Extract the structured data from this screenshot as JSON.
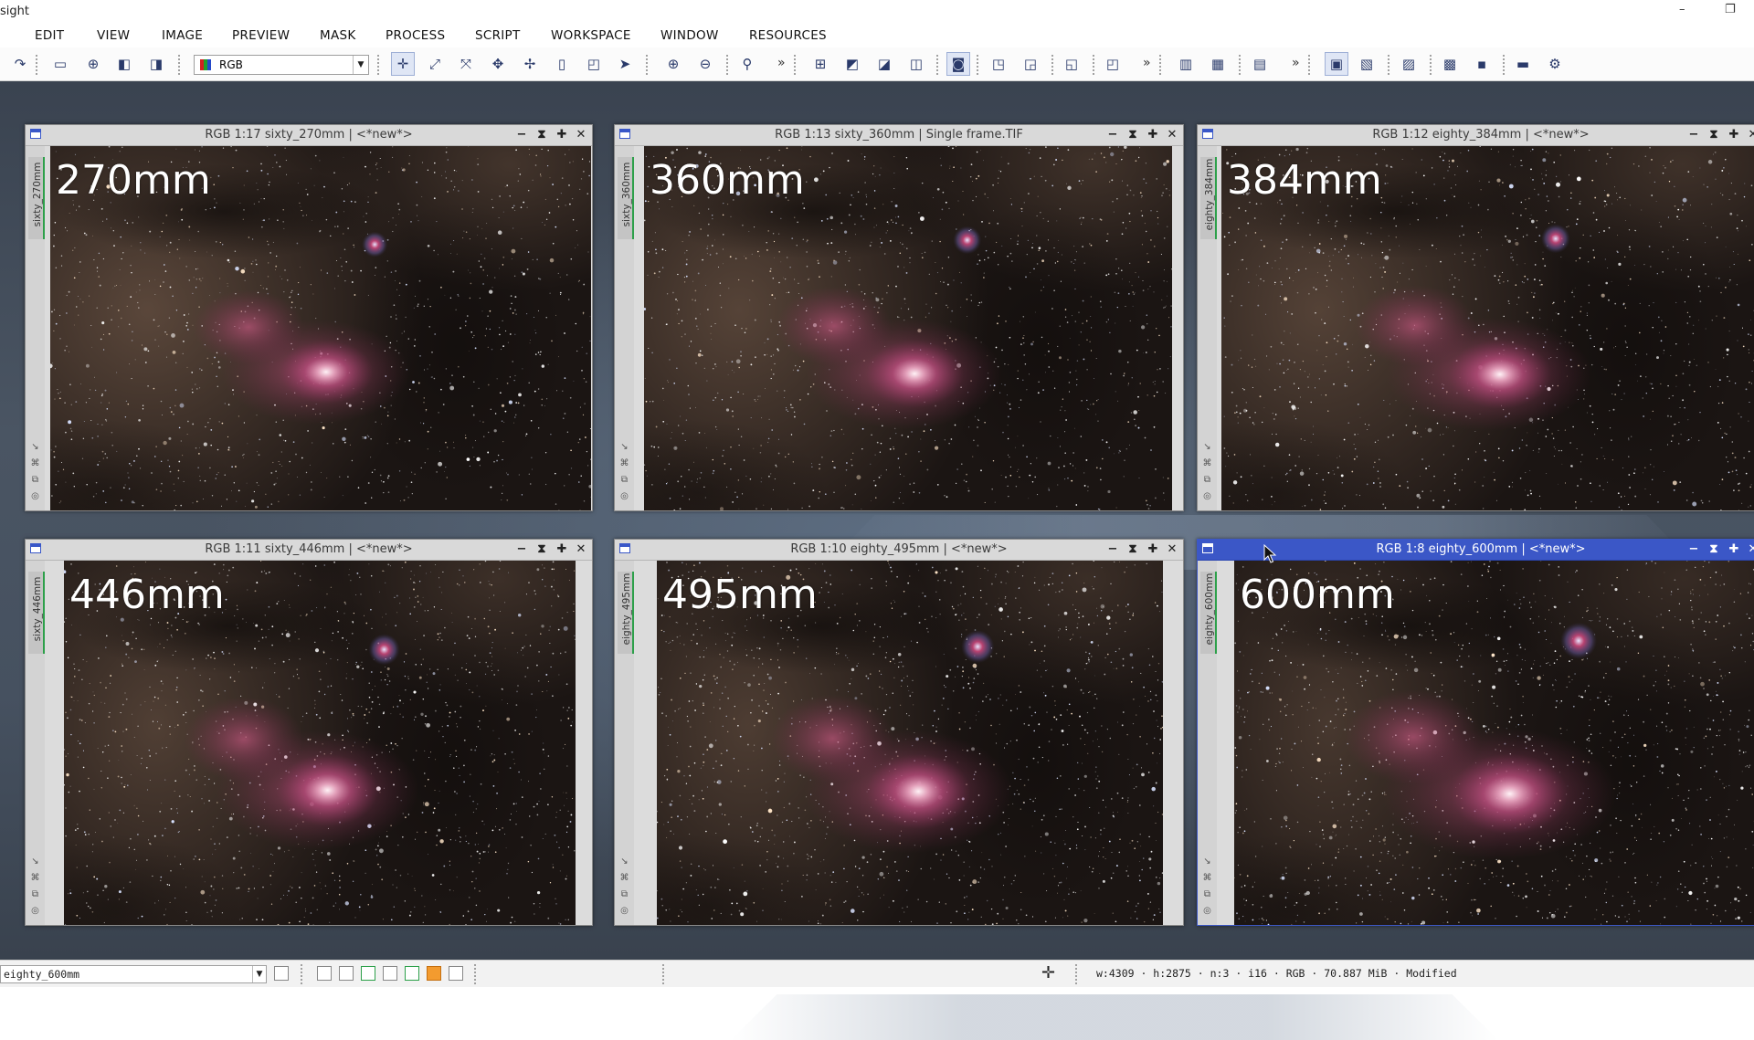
{
  "app": {
    "title": "sight",
    "window_controls": {
      "minimize": "–",
      "restore": "❐"
    }
  },
  "menubar": [
    "EDIT",
    "VIEW",
    "IMAGE",
    "PREVIEW",
    "MASK",
    "PROCESS",
    "SCRIPT",
    "WORKSPACE",
    "WINDOW",
    "RESOURCES"
  ],
  "toolbar": {
    "rgb_combo": {
      "value": "RGB"
    },
    "more_glyph": "»"
  },
  "windows": [
    {
      "title": "RGB 1:17 sixty_270mm | <*new*>",
      "side_label": "sixty_270mm",
      "focal_label": "270mm",
      "active": false,
      "zoom": 0.5
    },
    {
      "title": "RGB 1:13 sixty_360mm | Single frame.TIF",
      "side_label": "sixty_360mm",
      "focal_label": "360mm",
      "active": false,
      "zoom": 0.62
    },
    {
      "title": "RGB 1:12 eighty_384mm | <*new*>",
      "side_label": "eighty_384mm",
      "focal_label": "384mm",
      "active": false,
      "zoom": 0.66
    },
    {
      "title": "RGB 1:11 sixty_446mm | <*new*>",
      "side_label": "sixty_446mm",
      "focal_label": "446mm",
      "active": false,
      "zoom": 0.76
    },
    {
      "title": "RGB 1:10 eighty_495mm | <*new*>",
      "side_label": "eighty_495mm",
      "focal_label": "495mm",
      "active": false,
      "zoom": 0.84
    },
    {
      "title": "RGB 1:8 eighty_600mm | <*new*>",
      "side_label": "eighty_600mm",
      "focal_label": "600mm",
      "active": true,
      "zoom": 1.0
    }
  ],
  "window_controls": {
    "shade": "−",
    "maximize": "⧗",
    "iconize": "✚",
    "close": "✕"
  },
  "statusbar": {
    "view_combo": "eighty_600mm",
    "info": "w:4309 · h:2875 · n:3 · i16 · RGB · 70.887 MiB · Modified"
  },
  "colors": {
    "active_title": "#3b57c7",
    "inactive_title": "#d9d9d9",
    "tab_accent": "#2da04a"
  },
  "icons": [
    "redo-icon",
    "new-image-icon",
    "open-icon",
    "save-icon",
    "channel-icon",
    "pan-icon",
    "fit-icon",
    "zoom-fit-icon",
    "zoom-in-icon",
    "zoom-out-icon",
    "preview-icon",
    "process-icon"
  ]
}
